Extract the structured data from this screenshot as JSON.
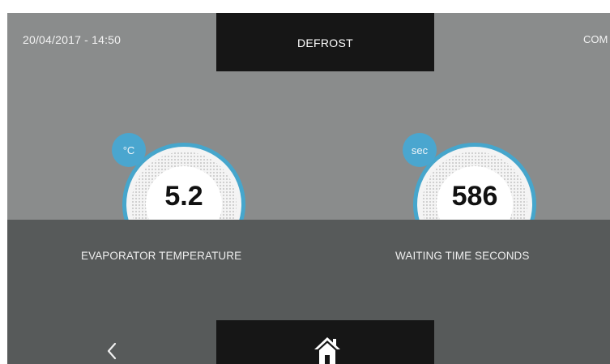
{
  "header": {
    "datetime": "20/04/2017 - 14:50",
    "title": "DEFROST",
    "right_text": "COM"
  },
  "gauges": [
    {
      "unit": "°C",
      "value": "5.2",
      "label": "EVAPORATOR TEMPERATURE"
    },
    {
      "unit": "sec",
      "value": "586",
      "label": "WAITING TIME SECONDS"
    }
  ],
  "nav": {
    "back_icon": "chevron-left-icon",
    "home_icon": "home-icon"
  },
  "colors": {
    "screen_bg": "#8a8c8c",
    "panel_bg": "#575a5a",
    "bar_bg": "#161616",
    "accent": "#46a6cc"
  }
}
